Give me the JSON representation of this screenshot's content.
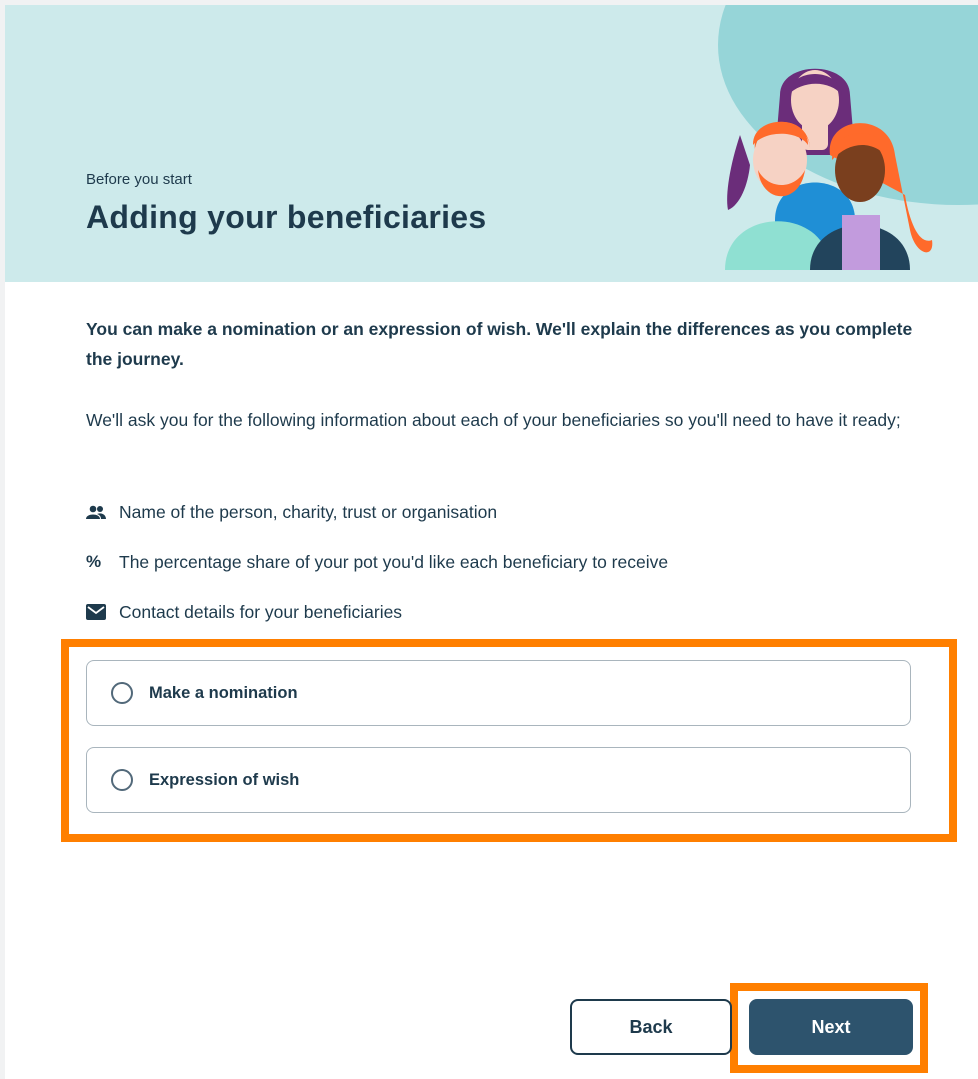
{
  "header": {
    "eyebrow": "Before you start",
    "title": "Adding your beneficiaries"
  },
  "content": {
    "intro": "You can make a nomination or an expression of wish. We'll explain the differences as you complete the journey.",
    "description": "We'll ask you for the following information about each of your beneficiaries so you'll need to have it ready;",
    "items": [
      {
        "icon": "people-icon",
        "text": "Name of the person, charity, trust or organisation"
      },
      {
        "icon": "percent-icon",
        "glyph": "%",
        "text": "The percentage share of your pot you'd like each beneficiary to receive"
      },
      {
        "icon": "envelope-icon",
        "text": "Contact details for your beneficiaries"
      }
    ]
  },
  "options": [
    {
      "label": "Make a nomination",
      "selected": false
    },
    {
      "label": "Expression of wish",
      "selected": false
    }
  ],
  "actions": {
    "back_label": "Back",
    "next_label": "Next"
  },
  "colors": {
    "hero_background": "#cdeaeb",
    "hero_blob": "#96d5d8",
    "text_primary": "#1e3a4c",
    "primary_button": "#2d536d",
    "highlight": "#ff7f00"
  }
}
